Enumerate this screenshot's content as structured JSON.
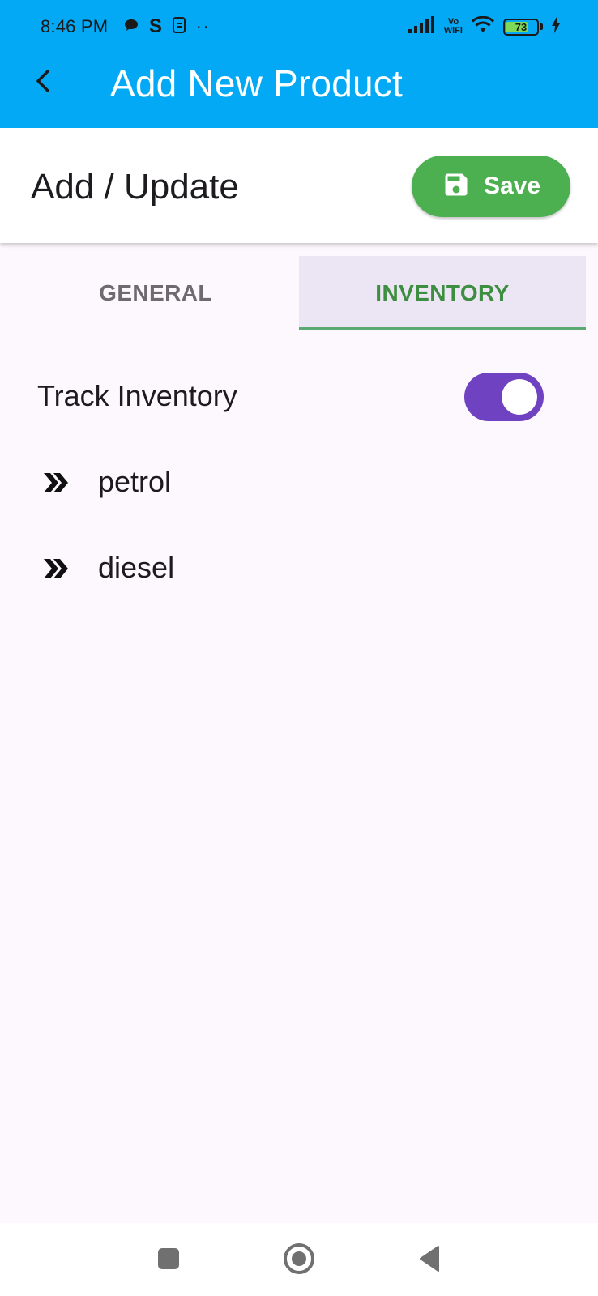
{
  "status_bar": {
    "time": "8:46 PM",
    "left_icons": [
      "chat-bubble-icon",
      "s-app-icon",
      "sim-icon",
      "more-dots-icon"
    ],
    "s_glyph": "S",
    "dots": "··",
    "vowifi_top": "Vo",
    "vowifi_bottom": "WiFi",
    "battery_percent": "73",
    "battery_level": 0.73,
    "right_icons": [
      "signal-icon",
      "vowifi-icon",
      "wifi-icon",
      "battery-icon",
      "charging-icon"
    ]
  },
  "app_bar": {
    "title": "Add New Product",
    "back_icon": "chevron-left-icon",
    "color": "#03a9f4"
  },
  "section": {
    "title": "Add / Update",
    "save_label": "Save",
    "save_icon": "floppy-disk-icon",
    "save_color": "#4caf50"
  },
  "tabs": [
    {
      "label": "GENERAL",
      "selected": false
    },
    {
      "label": "INVENTORY",
      "selected": true
    }
  ],
  "inventory": {
    "track_label": "Track Inventory",
    "track_enabled": true,
    "toggle_color": "#6f42c1",
    "items": [
      {
        "label": "petrol",
        "icon": "double-chevron-right-icon"
      },
      {
        "label": "diesel",
        "icon": "double-chevron-right-icon"
      }
    ]
  },
  "nav_bar": {
    "buttons": [
      "recents-square-icon",
      "home-circle-icon",
      "back-triangle-icon"
    ]
  }
}
